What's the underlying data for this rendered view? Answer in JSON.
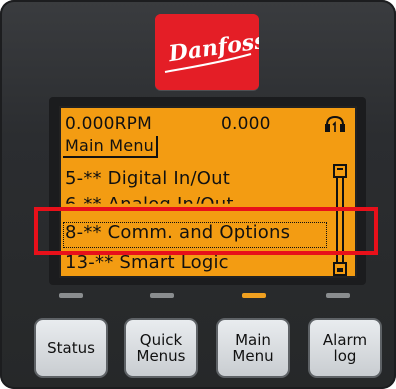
{
  "logo": {
    "brand": "Danfoss"
  },
  "display": {
    "speed": "0.000RPM",
    "value": "0.000",
    "mode_icon": "hand-on-icon",
    "menu_title": "Main Menu",
    "menu_items": [
      "5-** Digital In/Out",
      "6-** Analog In/Out",
      "8-** Comm. and Options",
      "13-** Smart Logic"
    ],
    "selected_index": 2
  },
  "buttons": {
    "status": "Status",
    "quick_menus": "Quick\nMenus",
    "main_menu": "Main\nMenu",
    "alarm_log": "Alarm\nlog"
  },
  "leds": {
    "active": "main_menu",
    "active_color": "#f0a020",
    "inactive_color": "#8a8d8f"
  },
  "colors": {
    "lcd_background": "#f39c12",
    "logo_red": "#e41e26",
    "highlight_red": "#e8101a"
  }
}
